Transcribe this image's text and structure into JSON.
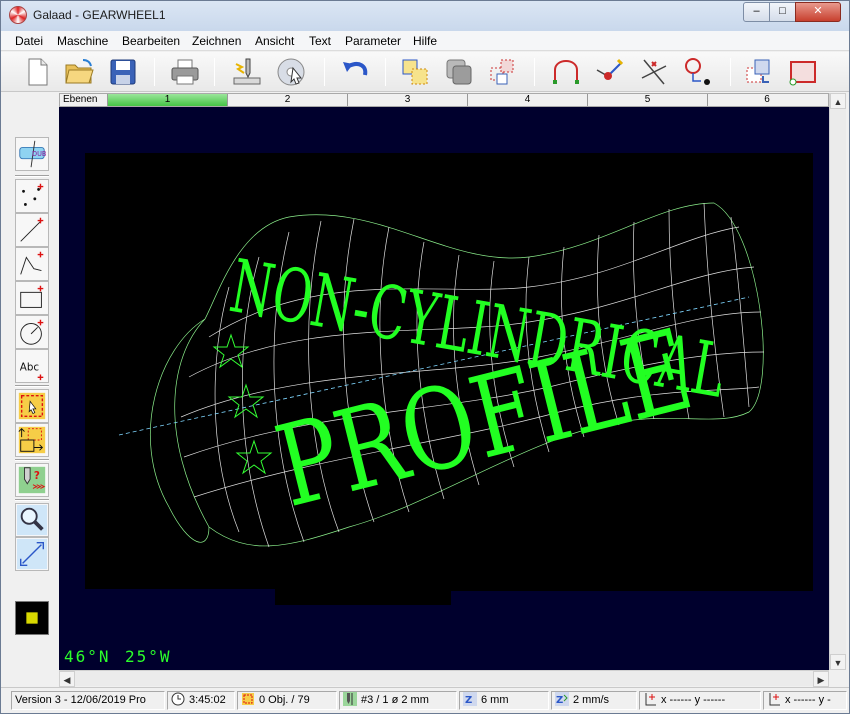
{
  "window": {
    "app_name": "Galaad",
    "separator": " - ",
    "document": "GEARWHEEL1",
    "min_glyph": "‒",
    "max_glyph": "□",
    "close_glyph": "✕"
  },
  "menu": [
    "Datei",
    "Maschine",
    "Bearbeiten",
    "Zeichnen",
    "Ansicht",
    "Text",
    "Parameter",
    "Hilfe"
  ],
  "toolbar": {
    "icons": [
      "new-file-icon",
      "open-folder-icon",
      "save-disk-icon",
      "print-icon",
      "machining-icon",
      "cd-pointer-icon",
      "undo-icon",
      "copy-transform-icon",
      "group-icon",
      "array-icon",
      "arc-node-icon",
      "point-line-icon",
      "trim-icon",
      "circle-point-icon",
      "layer-copy-icon",
      "rectangle-frame-icon"
    ]
  },
  "layers": {
    "label": "Ebenen",
    "cells": [
      "1",
      "2",
      "3",
      "4",
      "5",
      "6"
    ],
    "active_index": 0
  },
  "toolbox": {
    "icons": [
      "text-label-icon",
      "points-icon",
      "line-icon",
      "polyline-icon",
      "rectangle-icon",
      "circle-icon",
      "text-abc-icon",
      "select-frame-icon",
      "move-copy-icon",
      "drill-icon",
      "zoom-icon",
      "measure-icon",
      "color-swatch-icon"
    ],
    "text_abc": "Abc",
    "text_label": "DUB",
    "swatch_color": "#d8d800"
  },
  "canvas": {
    "bg_color": "#00002d",
    "sheet_color": "#000000",
    "wire_color": "#e0e0e0",
    "text_color": "#22ff22",
    "text_line1": "NON-CYLINDRICAL",
    "text_line2": "PROFILE",
    "readout_left": "46°N",
    "readout_right": "25°W"
  },
  "status": {
    "version": "Version 3 - 12/06/2019  Pro",
    "time": "3:45:02",
    "objects": "0 Obj. / 79",
    "tool": "#3 / 1   ø 2 mm",
    "depth": "6 mm",
    "speed": "2 mm/s",
    "coords1": "x ------   y ------",
    "coords2": "x ------   y -"
  }
}
